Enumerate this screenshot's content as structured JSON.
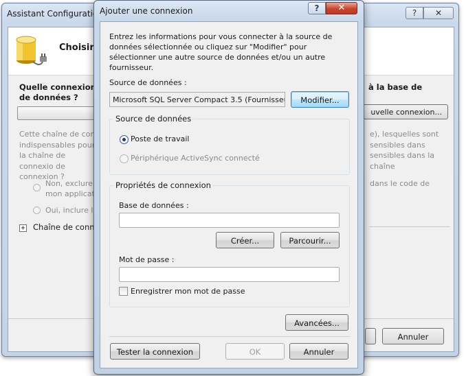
{
  "wizard": {
    "title": "Assistant Configuration",
    "heading": "Choisir v",
    "question_left": "Quelle connexion de données ?",
    "question_right": "à la base de",
    "new_connection_label": "uvelle connexion...",
    "para_left": "Cette chaîne de conn indispensables pour c la chaîne de connexio de connexion ?",
    "para_right": "e), lesquelles sont sensibles dans sensibles dans la chaîne",
    "option_no": "Non, exclure l mon applicati",
    "option_yes": "Oui, inclure le",
    "option_right": "dans le code de",
    "chain_label": "Chaîne de conne",
    "cancel_label": "Annuler",
    "help_glyph": "?",
    "close_glyph": "✕"
  },
  "dialog": {
    "title": "Ajouter une connexion",
    "help_glyph": "?",
    "close_glyph": "✕",
    "intro": "Entrez les informations pour vous connecter à la source de données sélectionnée ou cliquez sur \"Modifier\" pour sélectionner une autre source de données et/ou un autre fournisseur.",
    "datasource_label": "Source de données :",
    "datasource_value": "Microsoft SQL Server Compact 3.5 (Fournisseur",
    "modify_label": "Modifier...",
    "datasource_group": {
      "title": "Source de données",
      "option_workstation": "Poste de travail",
      "option_activesync": "Périphérique ActiveSync connecté",
      "selected": "Poste de travail"
    },
    "connection_group": {
      "title": "Propriétés de connexion",
      "database_label": "Base de données :",
      "database_value": "",
      "create_label": "Créer...",
      "browse_label": "Parcourir...",
      "password_label": "Mot de passe :",
      "password_value": "",
      "save_password_label": "Enregistrer mon mot de passe",
      "save_password_checked": false
    },
    "advanced_label": "Avancées...",
    "test_label": "Tester la connexion",
    "ok_label": "OK",
    "cancel_label": "Annuler"
  }
}
